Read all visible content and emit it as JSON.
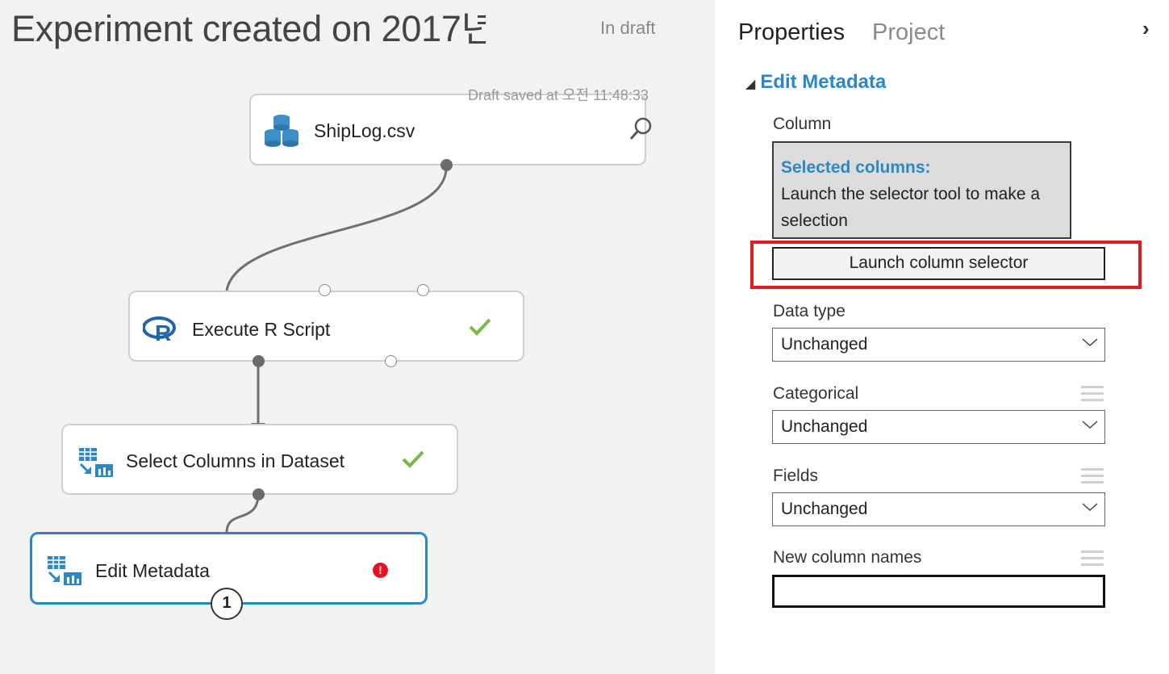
{
  "canvas": {
    "title": "Experiment created on 2017년",
    "status": "In draft",
    "draft_saved": "Draft saved at 오전 11:48:33",
    "modules": [
      {
        "label": "ShipLog.csv",
        "icon": "dataset-icon",
        "status": "",
        "side_icon": "magnifier-icon"
      },
      {
        "label": "Execute R Script",
        "icon": "r-logo-icon",
        "status": "success"
      },
      {
        "label": "Select Columns in Dataset",
        "icon": "table-transform-icon",
        "status": "success"
      },
      {
        "label": "Edit Metadata",
        "icon": "table-transform-icon",
        "status": "error",
        "selected": true,
        "badge": "1"
      }
    ],
    "status_error_glyph": "!"
  },
  "panel": {
    "tabs": [
      "Properties",
      "Project"
    ],
    "active_tab": "Properties",
    "collapse_glyph": "›",
    "section": {
      "toggle_glyph": "◢",
      "title": "Edit Metadata"
    },
    "column_label": "Column",
    "selected_columns": {
      "title": "Selected columns:",
      "text": "Launch the selector tool to make a selection"
    },
    "launch_button": "Launch column selector",
    "fields": [
      {
        "label": "Data type",
        "value": "Unchanged",
        "has_param_icon": false
      },
      {
        "label": "Categorical",
        "value": "Unchanged",
        "has_param_icon": true
      },
      {
        "label": "Fields",
        "value": "Unchanged",
        "has_param_icon": true
      }
    ],
    "new_column_names": {
      "label": "New column names",
      "value": ""
    }
  },
  "colors": {
    "accent": "#2b88c5",
    "success": "#7ab648",
    "error": "#e81123",
    "highlight": "#e31b23",
    "canvas_bg": "#f2f2f2"
  }
}
